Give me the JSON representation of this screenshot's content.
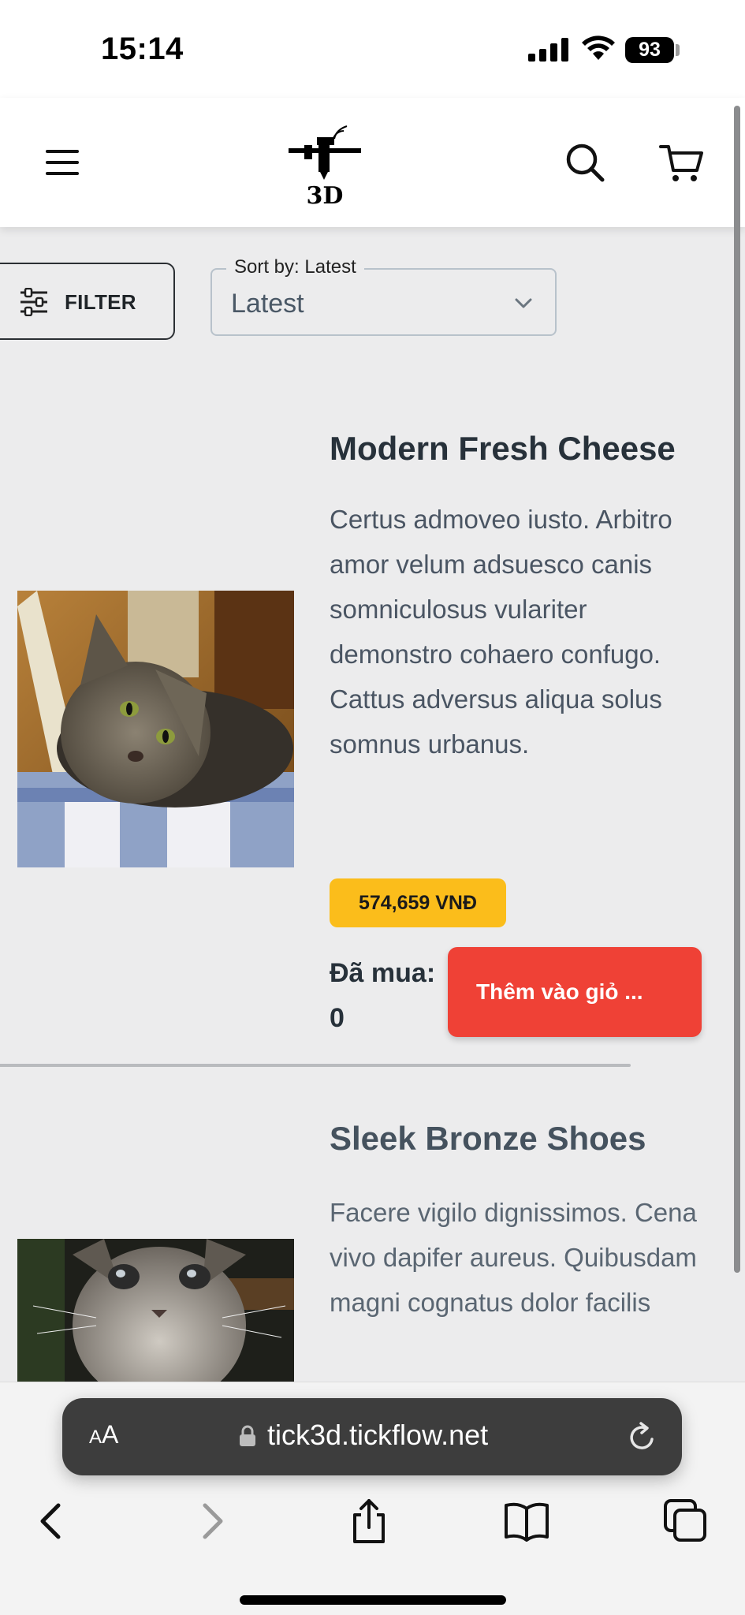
{
  "status_bar": {
    "time": "15:14",
    "battery": "93"
  },
  "header": {
    "logo_text": "3D",
    "icons": [
      "menu-icon",
      "search-icon",
      "cart-icon"
    ]
  },
  "toolbar": {
    "filter_label": "FILTER",
    "sort_legend": "Sort by: Latest",
    "sort_value": "Latest"
  },
  "products": [
    {
      "title": "Modern Fresh Cheese",
      "description": "Certus admoveo iusto. Arbitro amor velum adsuesco canis somniculosus vulariter demonstro cohaero confugo. Cattus adversus aliqua solus somnus urbanus.",
      "price": "574,659 VNĐ",
      "purchased": "Đã mua: 0",
      "add_to_cart": "Thêm vào giỏ ..."
    },
    {
      "title": "Sleek Bronze Shoes",
      "description": "Facere vigilo dignissimos. Cena vivo dapifer aureus. Quibusdam magni cognatus dolor facilis"
    }
  ],
  "browser": {
    "aa_small": "A",
    "aa_large": "A",
    "url": "tick3d.tickflow.net"
  },
  "colors": {
    "accent_red": "#ef4136",
    "price_yellow": "#fbbd1b",
    "page_bg": "#ececed"
  }
}
